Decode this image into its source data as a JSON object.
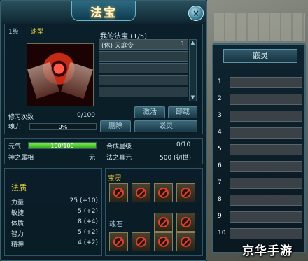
{
  "window": {
    "title": "法宝",
    "close_icon": "×"
  },
  "treasure": {
    "level": "1级",
    "type": "速型"
  },
  "my_treasures": {
    "title": "我的法宝 (1/5)",
    "items": [
      {
        "name": "(休) 天庭令",
        "count": "1"
      },
      {
        "name": "",
        "count": ""
      },
      {
        "name": "",
        "count": ""
      },
      {
        "name": "",
        "count": ""
      },
      {
        "name": "",
        "count": ""
      }
    ],
    "scroll_up": "▲",
    "scroll_down": "▼"
  },
  "actions": {
    "activate": "激活",
    "unload": "卸载",
    "delete": "删除",
    "embed": "嵌灵"
  },
  "practice": {
    "count_label": "修习次数",
    "count_value": "0/100",
    "soul_label": "魂力",
    "soul_value": "0%",
    "soul_percent": 0
  },
  "stats": {
    "yuanqi_label": "元气",
    "yuanqi_value": "100/100",
    "yuanqi_percent": 100,
    "star_label": "合成星级",
    "star_value": "0/10",
    "god_attr_label": "神之属相",
    "god_attr_value": "无",
    "true_origin_label": "法之真元",
    "true_origin_value": "500 (初世)"
  },
  "quality": {
    "title": "法质",
    "rows": [
      {
        "label": "力量",
        "value": "25 (+10)"
      },
      {
        "label": "敏捷",
        "value": "5 (+2)"
      },
      {
        "label": "体质",
        "value": "8 (+4)"
      },
      {
        "label": "智力",
        "value": "5 (+2)"
      },
      {
        "label": "精神",
        "value": "4 (+2)"
      }
    ]
  },
  "spirit": {
    "title": "宝灵",
    "stone_title": "魂石"
  },
  "embed_panel": {
    "title": "嵌灵",
    "rows": [
      "1",
      "2",
      "3",
      "4",
      "5",
      "6",
      "7",
      "8",
      "9",
      "10"
    ]
  },
  "watermark": "京华手游"
}
